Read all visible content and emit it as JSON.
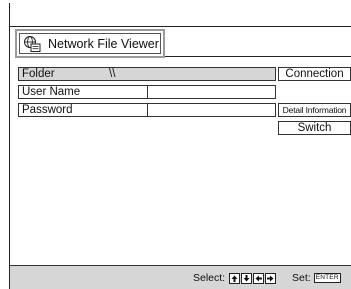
{
  "window": {
    "title": "Network File Viewer"
  },
  "form": {
    "folder_label": "Folder",
    "folder_value": "\\\\",
    "username_label": "User Name",
    "username_value": "",
    "password_label": "Password",
    "password_value": ""
  },
  "buttons": {
    "connection": "Connection",
    "detail_information": "Detail Information",
    "switch": "Switch"
  },
  "status": {
    "select_label": "Select:",
    "set_label": "Set:",
    "enter_key": "ENTER",
    "arrow_keys": [
      "up-arrow-icon",
      "down-arrow-icon",
      "left-arrow-icon",
      "right-arrow-icon"
    ]
  },
  "colors": {
    "highlight": "#d6d6d6",
    "title_frame": "#9a9a9a"
  }
}
